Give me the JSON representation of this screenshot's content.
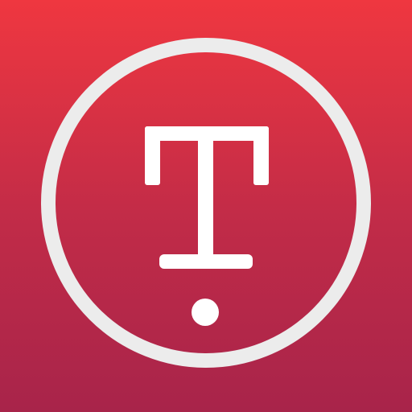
{
  "app_icon": {
    "glyph_icon": "t-exclamation-logo",
    "colors": {
      "gradient_top": "#ef3740",
      "gradient_bottom": "#a8244a",
      "ring": "#ececec",
      "glyph": "#ffffff"
    }
  }
}
